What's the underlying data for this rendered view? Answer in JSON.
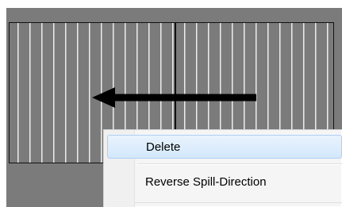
{
  "context_menu": {
    "items": [
      {
        "label": "Delete",
        "highlighted": true
      },
      {
        "label": "Reverse Spill-Direction",
        "highlighted": false
      }
    ]
  },
  "spill": {
    "direction": "left",
    "arrow_icon": "left-arrow-icon"
  },
  "colors": {
    "background": "#7b7b7b",
    "stripe": "#ececec",
    "outline": "#111111",
    "menu_highlight": "#d4e8fb"
  }
}
